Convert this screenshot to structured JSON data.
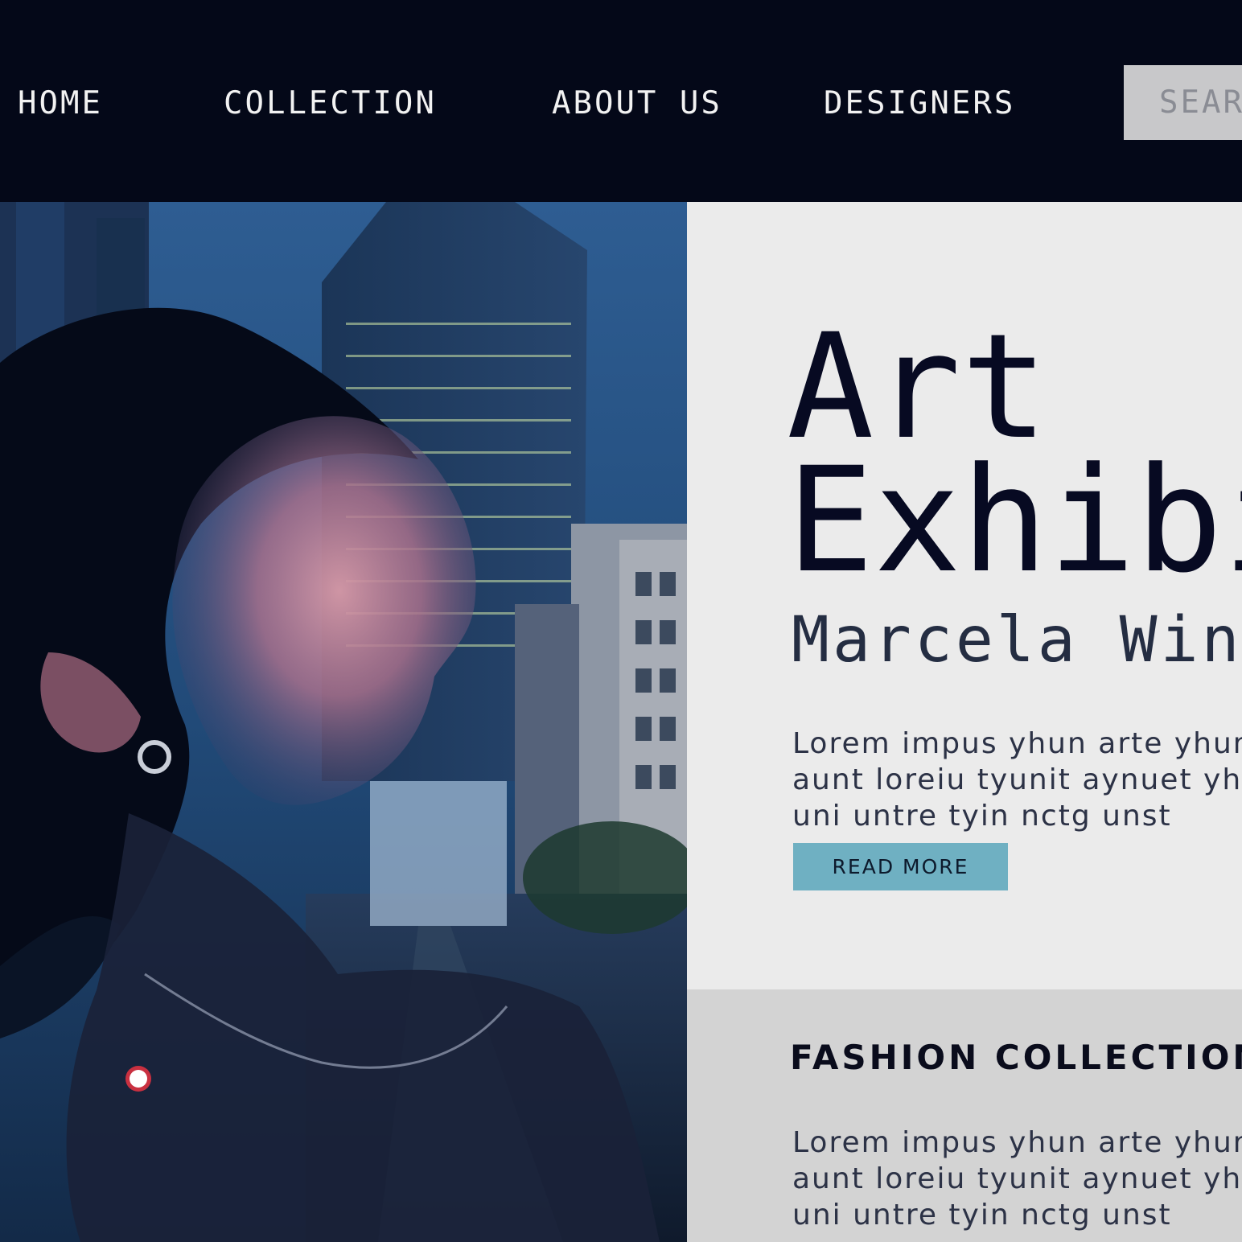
{
  "nav": {
    "items": [
      {
        "label": "HOME"
      },
      {
        "label": "COLLECTION"
      },
      {
        "label": "ABOUT US"
      },
      {
        "label": "DESIGNERS"
      }
    ],
    "search_label": "SEARCH"
  },
  "hero": {
    "image_description": "woman portrait double exposure with city skyscrapers",
    "headline_line1": "Art",
    "headline_line2": "Exhibition",
    "artist_name": "Marcela Winston",
    "description_lines": [
      "Lorem impus yhun arte yhun",
      "aunt loreiu tyunit aynuet yhun",
      "uni untre tyin nctg unst"
    ],
    "cta_label": "READ MORE"
  },
  "fashion": {
    "title": "FASHION COLLECTION",
    "description_lines": [
      "Lorem impus yhun arte yhun",
      "aunt loreiu tyunit aynuet yhun",
      "uni untre tyin nctg unst"
    ]
  },
  "colors": {
    "nav_background": "#040818",
    "search_background": "#c8c8ca",
    "panel_light": "#ebebeb",
    "panel_gray": "#d3d3d3",
    "accent": "#6fb0c2",
    "headline": "#070a22"
  }
}
